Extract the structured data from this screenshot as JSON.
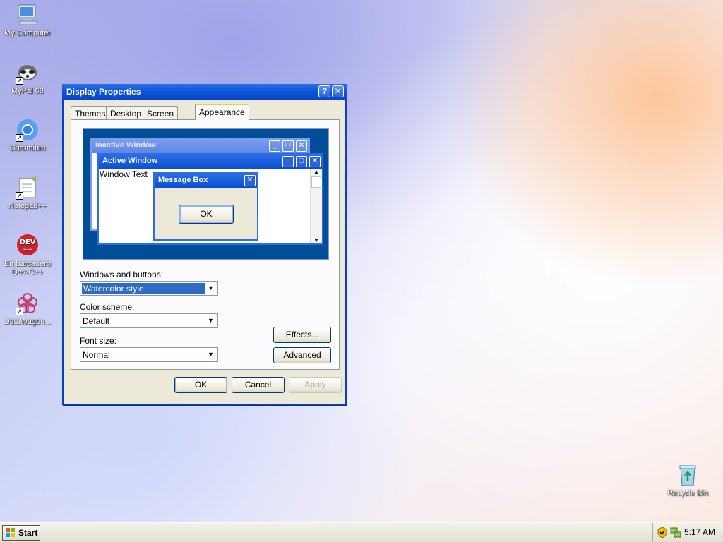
{
  "desktop": {
    "icons": [
      {
        "label": "My Computer",
        "icon": "computer-icon"
      },
      {
        "label": "MyPal 68",
        "icon": "raccoon-icon"
      },
      {
        "label": "Chromium",
        "icon": "chromium-icon"
      },
      {
        "label": "Notepad++",
        "icon": "notepad-icon"
      },
      {
        "label": "Embarcadero Dev-C++",
        "icon": "devcpp-icon"
      },
      {
        "label": "DataWagon...",
        "icon": "flower-icon"
      },
      {
        "label": "Recycle Bin",
        "icon": "recycle-bin-icon"
      }
    ]
  },
  "dialog": {
    "title": "Display Properties",
    "help": "?",
    "close": "✕",
    "tabs": [
      "Themes",
      "Desktop",
      "Screen Saver",
      "Appearance"
    ],
    "active_tab": "Appearance",
    "preview": {
      "inactive_title": "Inactive Window",
      "active_title": "Active Window",
      "window_text": "Window Text",
      "message_title": "Message Box",
      "ok": "OK"
    },
    "windows_buttons_label": "Windows and buttons:",
    "windows_buttons_value": "Watercolor style",
    "color_scheme_label": "Color scheme:",
    "color_scheme_value": "Default",
    "font_size_label": "Font size:",
    "font_size_value": "Normal",
    "effects_label": "Effects...",
    "advanced_label": "Advanced",
    "ok_label": "OK",
    "cancel_label": "Cancel",
    "apply_label": "Apply"
  },
  "taskbar": {
    "start_label": "Start",
    "clock": "5:17 AM"
  },
  "colors": {
    "title_blue": "#0d53d8",
    "preview_bg": "#004e98",
    "selection": "#316ac5",
    "dialog_bg": "#ece9d8"
  }
}
